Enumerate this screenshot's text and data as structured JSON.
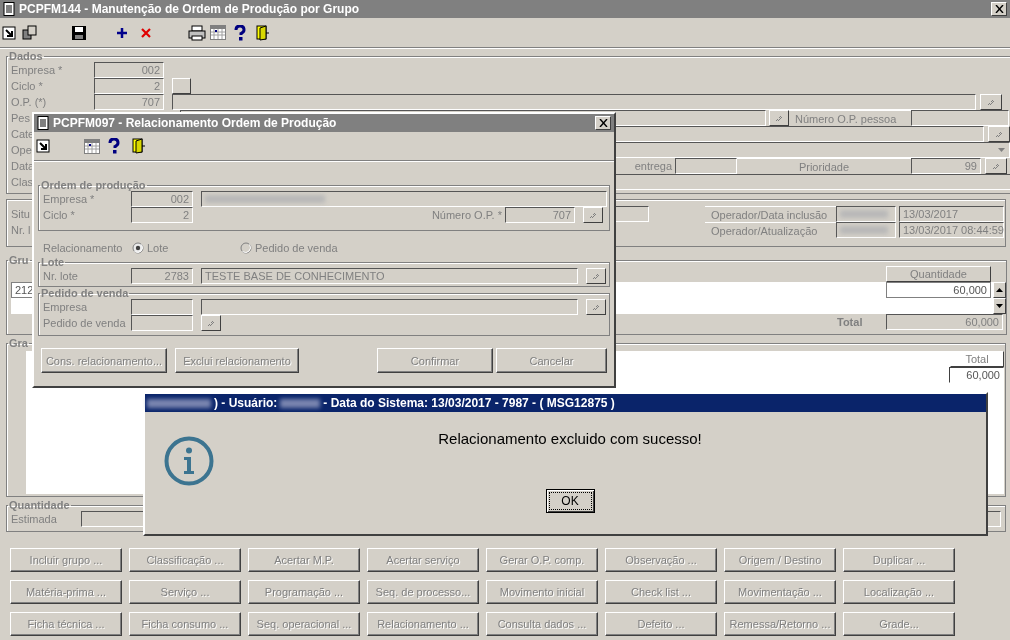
{
  "main_window": {
    "title": "PCPFM144 - Manutenção de Ordem de Produção por Grupo",
    "dados": {
      "legend": "Dados",
      "empresa": {
        "label": "Empresa *",
        "value": "002"
      },
      "ciclo": {
        "label": "Ciclo *",
        "value": "2"
      },
      "op": {
        "label": "O.P. (*)",
        "value": "707"
      },
      "row_4_label": "Pes",
      "numero_op_pessoa_label": "Número O.P. pessoa",
      "row_5_label": "Cate",
      "row_6_label": "Ope",
      "row_7_label": "Data",
      "entrega_label": "entrega",
      "prioridade": {
        "label": "Prioridade",
        "value": "99"
      },
      "row_8_label": "Clas"
    },
    "situacao": {
      "row_1_label": "Situ",
      "row_2_label": "Nr. l",
      "inclusao": {
        "label": "Operador/Data inclusão",
        "value": "13/03/2017"
      },
      "atualizacao": {
        "label": "Operador/Atualização",
        "value": "13/03/2017 08:44:59"
      }
    },
    "grupo": {
      "legend": "Gru",
      "column": "Quantidade",
      "rows": [
        {
          "column_1": "212",
          "quantidade": "60,000"
        }
      ],
      "total_label": "Total",
      "total": "60,000"
    },
    "grade": {
      "legend": "Gra",
      "column": "Total",
      "total": "60,000"
    },
    "quantidade": {
      "legend": "Quantidade",
      "estimada_label": "Estimada"
    },
    "buttons": [
      [
        "Incluir grupo ...",
        "Classificação ...",
        "Acertar M.P.",
        "Acertar serviço",
        "Gerar O.P. comp.",
        "Observação ...",
        "Origem / Destino",
        "Duplicar ..."
      ],
      [
        "Matéria-prima ...",
        "Serviço ...",
        "Programação ...",
        "Seq. de processo...",
        "Movimento inicial",
        "Check list ...",
        "Movimentação ...",
        "Localização ..."
      ],
      [
        "Ficha técnica ...",
        "Ficha consumo ...",
        "Seq. operacional ...",
        "Relacionamento ...",
        "Consulta dados ...",
        "Defeito ...",
        "Remessa/Retorno ...",
        "Grade..."
      ]
    ]
  },
  "relacionamento_dialog": {
    "title": "PCPFM097 - Relacionamento Ordem de Produção",
    "ordem": {
      "legend": "Ordem de produção",
      "empresa": {
        "label": "Empresa *",
        "value": "002"
      },
      "ciclo": {
        "label": "Ciclo *",
        "value": "2"
      },
      "numero_op": {
        "label": "Número O.P. *",
        "value": "707"
      }
    },
    "relacionamento": {
      "label": "Relacionamento",
      "options": [
        {
          "label": "Lote",
          "selected": true
        },
        {
          "label": "Pedido de venda",
          "selected": false
        }
      ]
    },
    "lote": {
      "legend": "Lote",
      "label": "Nr. lote",
      "value": "2783",
      "description": "TESTE BASE DE CONHECIMENTO"
    },
    "pedido": {
      "legend": "Pedido de venda",
      "empresa_label": "Empresa",
      "pedido_label": "Pedido de venda"
    },
    "buttons": [
      "Cons. relacionamento...",
      "Exclui relacionamento",
      "Confirmar",
      "Cancelar"
    ]
  },
  "message_dialog": {
    "title_parts": [
      {
        "kind": "blurred"
      },
      {
        "kind": "text",
        "text": ") - Usuário:"
      },
      {
        "kind": "blurred"
      },
      {
        "kind": "text",
        "text": "- Data do Sistema: 13/03/2017 - 7987 - ( MSG12875 )"
      }
    ],
    "message": "Relacionamento excluido com sucesso!",
    "button": "OK"
  }
}
